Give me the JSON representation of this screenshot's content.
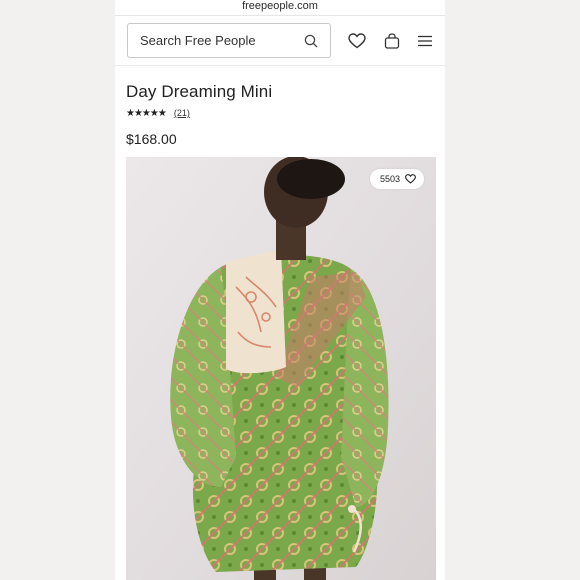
{
  "browser": {
    "url": "freepeople.com"
  },
  "header": {
    "search_placeholder": "Search Free People",
    "icons": [
      "search-icon",
      "heart-icon",
      "bag-icon",
      "menu-icon"
    ]
  },
  "product": {
    "title": "Day Dreaming Mini",
    "rating_stars": "★★★★★",
    "rating_value": 4.5,
    "review_count": "(21)",
    "price": "$168.00",
    "like_count": "5503"
  },
  "colors": {
    "dress_green": "#7aa84a",
    "dress_pink": "#d9866e",
    "background_page": "#f4f2f1"
  }
}
